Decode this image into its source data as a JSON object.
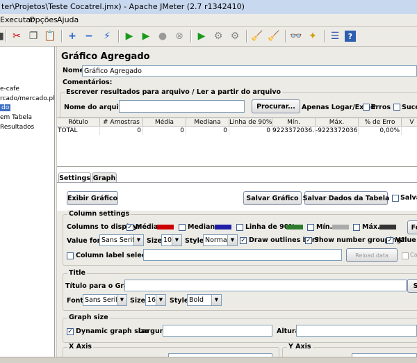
{
  "window": {
    "title": "ter\\Projetos\\Teste Cocatrel.jmx) - Apache JMeter (2.7 r1342410)"
  },
  "menu": [
    "Executar",
    "Opções",
    "Ajuda"
  ],
  "toolbar": {
    "icons": [
      "new",
      "cut",
      "copy",
      "paste",
      "add",
      "remove",
      "toggle",
      "start",
      "start-no-pause",
      "stop",
      "shutdown",
      "remote-start",
      "remote-stop",
      "remote-exit",
      "clear",
      "clear-all",
      "search",
      "reset-search",
      "function-helper",
      "help"
    ]
  },
  "tree": {
    "items": [
      "e-cafe",
      "rcado/mercado.php",
      "do",
      "em Tabela",
      "Resultados"
    ]
  },
  "panel": {
    "title": "Gráfico Agregado",
    "name_label": "Nome:",
    "name_value": "Gráfico Agregado",
    "comments_label": "Comentários:",
    "file_group_label": "Escrever resultados para arquivo / Ler a partir do arquivo",
    "filename_label": "Nome do arquivo",
    "browse_button": "Procurar...",
    "only_log_label": "Apenas Logar/Exibir",
    "errors_label": "Erros",
    "success_label": "Suces"
  },
  "table": {
    "headers": [
      "Rótulo",
      "# Amostras",
      "Média",
      "Mediana",
      "Linha de 90%",
      "Mín.",
      "Máx.",
      "% de Erro",
      "V"
    ],
    "rows": [
      [
        "TOTAL",
        "0",
        "0",
        "0",
        "0",
        "9223372036...",
        "-9223372036...",
        "0,00%",
        ""
      ]
    ]
  },
  "tabs": {
    "settings": "Settings",
    "graph": "Graph"
  },
  "settings": {
    "display_graph_button": "Exibir Gráfico",
    "save_graph_button": "Salvar Gráfico",
    "save_table_button": "Salvar Dados da Tabela",
    "save_check_label": "Salvar",
    "column_settings_label": "Column settings",
    "columns_to_display_label": "Columns to display:",
    "col_media": "Média",
    "col_mediana": "Mediana",
    "col_90": "Linha de 90%",
    "col_min": "Mín.",
    "col_max": "Máx.",
    "col_button": "Fo",
    "color_media": "#cc0000",
    "color_mediana": "#1f1fa8",
    "color_90": "#2e7d2e",
    "color_min": "#aaaaaa",
    "color_max": "#333333",
    "value_font_label": "Value font:",
    "value_font": "Sans Serif",
    "size_label": "Size:",
    "value_size": "10",
    "style_label": "Style:",
    "value_style": "Normal",
    "draw_outlines_label": "Draw outlines bar?",
    "number_grouping_label": "Show number grouping?",
    "value_label_label": "Value la",
    "column_label_selection_label": "Column label selection:",
    "reload_button": "Reload data",
    "case_label": "Case s"
  },
  "title_group": {
    "label": "Title",
    "graph_title_label": "Título para o Gráfico",
    "font_label": "Font:",
    "font": "Sans Serif",
    "size_label": "Size:",
    "size": "16",
    "style_label": "Style:",
    "style": "Bold",
    "side_button": "S"
  },
  "graph_size": {
    "label": "Graph size",
    "dynamic_label": "Dynamic graph size",
    "width_label": "Largura",
    "height_label": "Altura"
  },
  "axes": {
    "x_label": "X Axis",
    "y_label": "Y Axis"
  }
}
